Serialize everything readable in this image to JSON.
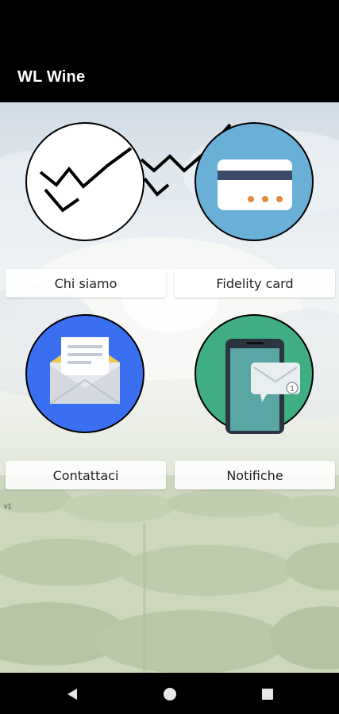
{
  "app": {
    "title": "WL Wine"
  },
  "tiles": [
    {
      "label": "Chi siamo",
      "icon": "zigzag-logo-icon"
    },
    {
      "label": "Fidelity card",
      "icon": "credit-card-icon"
    },
    {
      "label": "Contattaci",
      "icon": "open-envelope-icon"
    },
    {
      "label": "Notifiche",
      "icon": "phone-message-icon"
    }
  ],
  "version_label": "v1",
  "notification_badge": "1",
  "colors": {
    "card_circle": "#6aafd6",
    "mail_circle": "#3a6ff2",
    "phone_circle": "#3fae82",
    "card_stripe": "#3b4a6b",
    "card_dots": "#e08a3c"
  },
  "nav": {
    "back": "back-icon",
    "home": "home-icon",
    "recents": "recents-icon"
  }
}
